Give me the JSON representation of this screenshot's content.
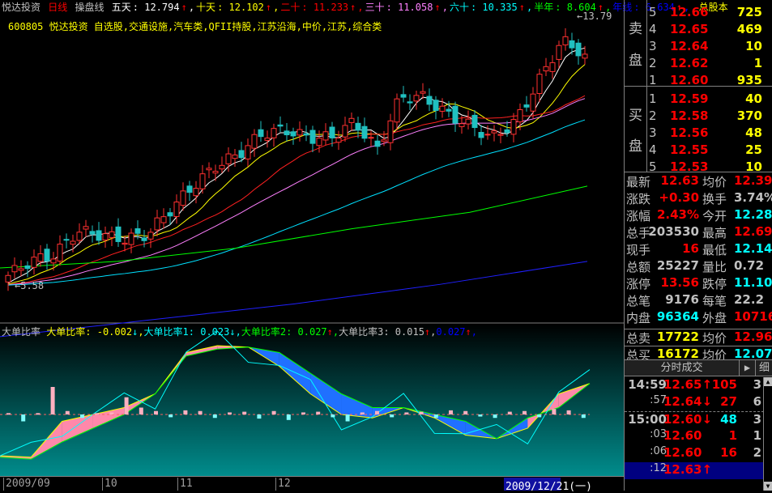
{
  "header": {
    "stock_name": "悦达投资",
    "period": "日线",
    "indicator": "操盘线",
    "ma": [
      {
        "label": "五天",
        "value": "12.794",
        "arrow": "↑",
        "color": "#ffffff"
      },
      {
        "label": "十天",
        "value": "12.102",
        "arrow": "↑",
        "color": "#ffff00"
      },
      {
        "label": "二十",
        "value": "11.233",
        "arrow": "↑",
        "color": "#ff0000"
      },
      {
        "label": "三十",
        "value": "11.058",
        "arrow": "↑",
        "color": "#ff80ff"
      },
      {
        "label": "六十",
        "value": "10.335",
        "arrow": "↑",
        "color": "#00ffff"
      },
      {
        "label": "半年",
        "value": "8.604",
        "arrow": "↑",
        "color": "#00ff00"
      },
      {
        "label": "年线",
        "value": "6.634",
        "arrow": "↑",
        "color": "#0000ff"
      }
    ],
    "extra": "总股本",
    "sector_line": "600805 悦达投资  自选股,交通设施,汽车类,QFII持股,江苏沿海,中价,江苏,综合类"
  },
  "chart_data": {
    "type": "candlestick",
    "price_max": 13.79,
    "price_min": 5.58,
    "max_label": "13.79",
    "min_label": "5.58",
    "key_closes": [
      5.87,
      6.32,
      6.49,
      7.23,
      7.11,
      6.98,
      7.11,
      7.85,
      8.59,
      9.21,
      9.58,
      10.2,
      10.32,
      10.08,
      10.08,
      10.57,
      9.71,
      11.32,
      11.32,
      10.82,
      10.45,
      10.08,
      10.57,
      11.81,
      13.05,
      12.63
    ],
    "year_line": [
      4.0,
      4.5,
      5.0,
      5.6,
      6.3
    ],
    "half_year_line": [
      6.1,
      6.3,
      6.7,
      7.3,
      7.8,
      8.6
    ],
    "indicator": {
      "title": "大单比率",
      "values": [
        {
          "label": "大单比率",
          "value": "-0.002",
          "arrow": "↓",
          "color": "#ffff00"
        },
        {
          "label": "大单比率1",
          "value": "0.023",
          "arrow": "↓",
          "color": "#00ffff"
        },
        {
          "label": "大单比率2",
          "value": "0.027",
          "arrow": "↑",
          "color": "#00ff00"
        },
        {
          "label": "大单比率3",
          "value": "0.015",
          "arrow": "↑",
          "color": "#c0c0c0"
        },
        {
          "label": "",
          "value": "0.027",
          "arrow": "↑",
          "color": "#0000ff"
        }
      ],
      "line_a": [
        -0.6,
        -0.62,
        -0.1,
        0.0,
        0.1,
        0.3,
        0.9,
        1.0,
        0.98,
        0.7,
        0.3,
        0.0,
        -0.05,
        0.1,
        -0.05,
        -0.3,
        -0.35,
        -0.2,
        0.3,
        0.45
      ],
      "line_b": [
        -0.62,
        -0.65,
        -0.4,
        -0.2,
        0.0,
        0.3,
        0.85,
        0.95,
        0.98,
        0.9,
        0.6,
        0.3,
        0.1,
        0.1,
        0.0,
        -0.1,
        -0.35,
        -0.05,
        0.1,
        0.45
      ],
      "bars": [
        0.02,
        -0.1,
        0.02,
        0.4,
        0.05,
        -0.05,
        0.02,
        0.03,
        0.25,
        0.1,
        0.05,
        -0.04,
        0.06,
        0.05,
        -0.05,
        0.03,
        0.04,
        -0.06,
        0.05,
        -0.08,
        0.03,
        0.04,
        -0.04,
        -0.1,
        0.03,
        0.05,
        -0.04,
        0.03,
        0.04,
        -0.05,
        0.06,
        0.05,
        -0.03,
        -0.05,
        0.04,
        0.05,
        -0.04,
        0.08,
        0.06,
        -0.05
      ]
    },
    "x_ticks": [
      "2009/09",
      "10",
      "11",
      "12"
    ],
    "current_date": "2009/12/21(一)"
  },
  "order_book": {
    "sell_label": [
      "卖",
      "盘"
    ],
    "buy_label": [
      "买",
      "盘"
    ],
    "sell": [
      {
        "n": "5",
        "p": "12.66",
        "v": "725"
      },
      {
        "n": "4",
        "p": "12.65",
        "v": "469"
      },
      {
        "n": "3",
        "p": "12.64",
        "v": "10"
      },
      {
        "n": "2",
        "p": "12.62",
        "v": "1"
      },
      {
        "n": "1",
        "p": "12.60",
        "v": "935"
      }
    ],
    "buy": [
      {
        "n": "1",
        "p": "12.59",
        "v": "40"
      },
      {
        "n": "2",
        "p": "12.58",
        "v": "370"
      },
      {
        "n": "3",
        "p": "12.56",
        "v": "48"
      },
      {
        "n": "4",
        "p": "12.55",
        "v": "25"
      },
      {
        "n": "5",
        "p": "12.53",
        "v": "10"
      }
    ]
  },
  "stats": [
    {
      "l1": "最新",
      "v1": "12.63",
      "c1": "#ff0000",
      "l2": "均价",
      "v2": "12.39",
      "c2": "#ff0000"
    },
    {
      "l1": "涨跌",
      "v1": "+0.30",
      "c1": "#ff0000",
      "l2": "换手",
      "v2": "3.74%",
      "c2": "#c0c0c0"
    },
    {
      "l1": "涨幅",
      "v1": "2.43%",
      "c1": "#ff0000",
      "l2": "今开",
      "v2": "12.28",
      "c2": "#00ffff"
    },
    {
      "l1": "总手",
      "v1": "203530",
      "c1": "#c0c0c0",
      "l2": "最高",
      "v2": "12.69",
      "c2": "#ff0000"
    },
    {
      "l1": "现手",
      "v1": "16",
      "c1": "#ff0000",
      "l2": "最低",
      "v2": "12.14",
      "c2": "#00ffff"
    },
    {
      "l1": "总额",
      "v1": "25227",
      "c1": "#c0c0c0",
      "l2": "量比",
      "v2": "0.72",
      "c2": "#c0c0c0"
    },
    {
      "l1": "涨停",
      "v1": "13.56",
      "c1": "#ff0000",
      "l2": "跌停",
      "v2": "11.10",
      "c2": "#00ffff"
    },
    {
      "l1": "总笔",
      "v1": "9176",
      "c1": "#c0c0c0",
      "l2": "每笔",
      "v2": "22.2",
      "c2": "#c0c0c0"
    },
    {
      "l1": "内盘",
      "v1": "96364",
      "c1": "#00ffff",
      "l2": "外盘",
      "v2": "107166",
      "c2": "#ff0000"
    },
    {
      "l1": "总卖",
      "v1": "17722",
      "c1": "#ffff00",
      "l2": "均价",
      "v2": "12.96",
      "c2": "#ff0000"
    },
    {
      "l1": "总买",
      "v1": "16172",
      "c1": "#ffff00",
      "l2": "均价",
      "v2": "12.07",
      "c2": "#00ffff"
    }
  ],
  "ticks_panel": {
    "tab": "分时成交",
    "play": "▶",
    "detail": "细",
    "rows": [
      {
        "t": "14:59",
        "p": "12.65↑",
        "v": "105",
        "vc": "#ff0000",
        "c": "3"
      },
      {
        "t": ":57",
        "p": "12.64↓",
        "v": "27",
        "vc": "#ff0000",
        "c": "6"
      },
      {
        "t": "15:00",
        "p": "12.60↓",
        "v": "48",
        "vc": "#00ffff",
        "c": "3"
      },
      {
        "t": ":03",
        "p": "12.60",
        "v": "1",
        "vc": "#ff0000",
        "c": "1"
      },
      {
        "t": ":06",
        "p": "12.60",
        "v": "16",
        "vc": "#ff0000",
        "c": "2"
      },
      {
        "t": ":12",
        "p": "12.63↑",
        "v": "",
        "vc": "#ff0000",
        "c": ""
      }
    ]
  }
}
